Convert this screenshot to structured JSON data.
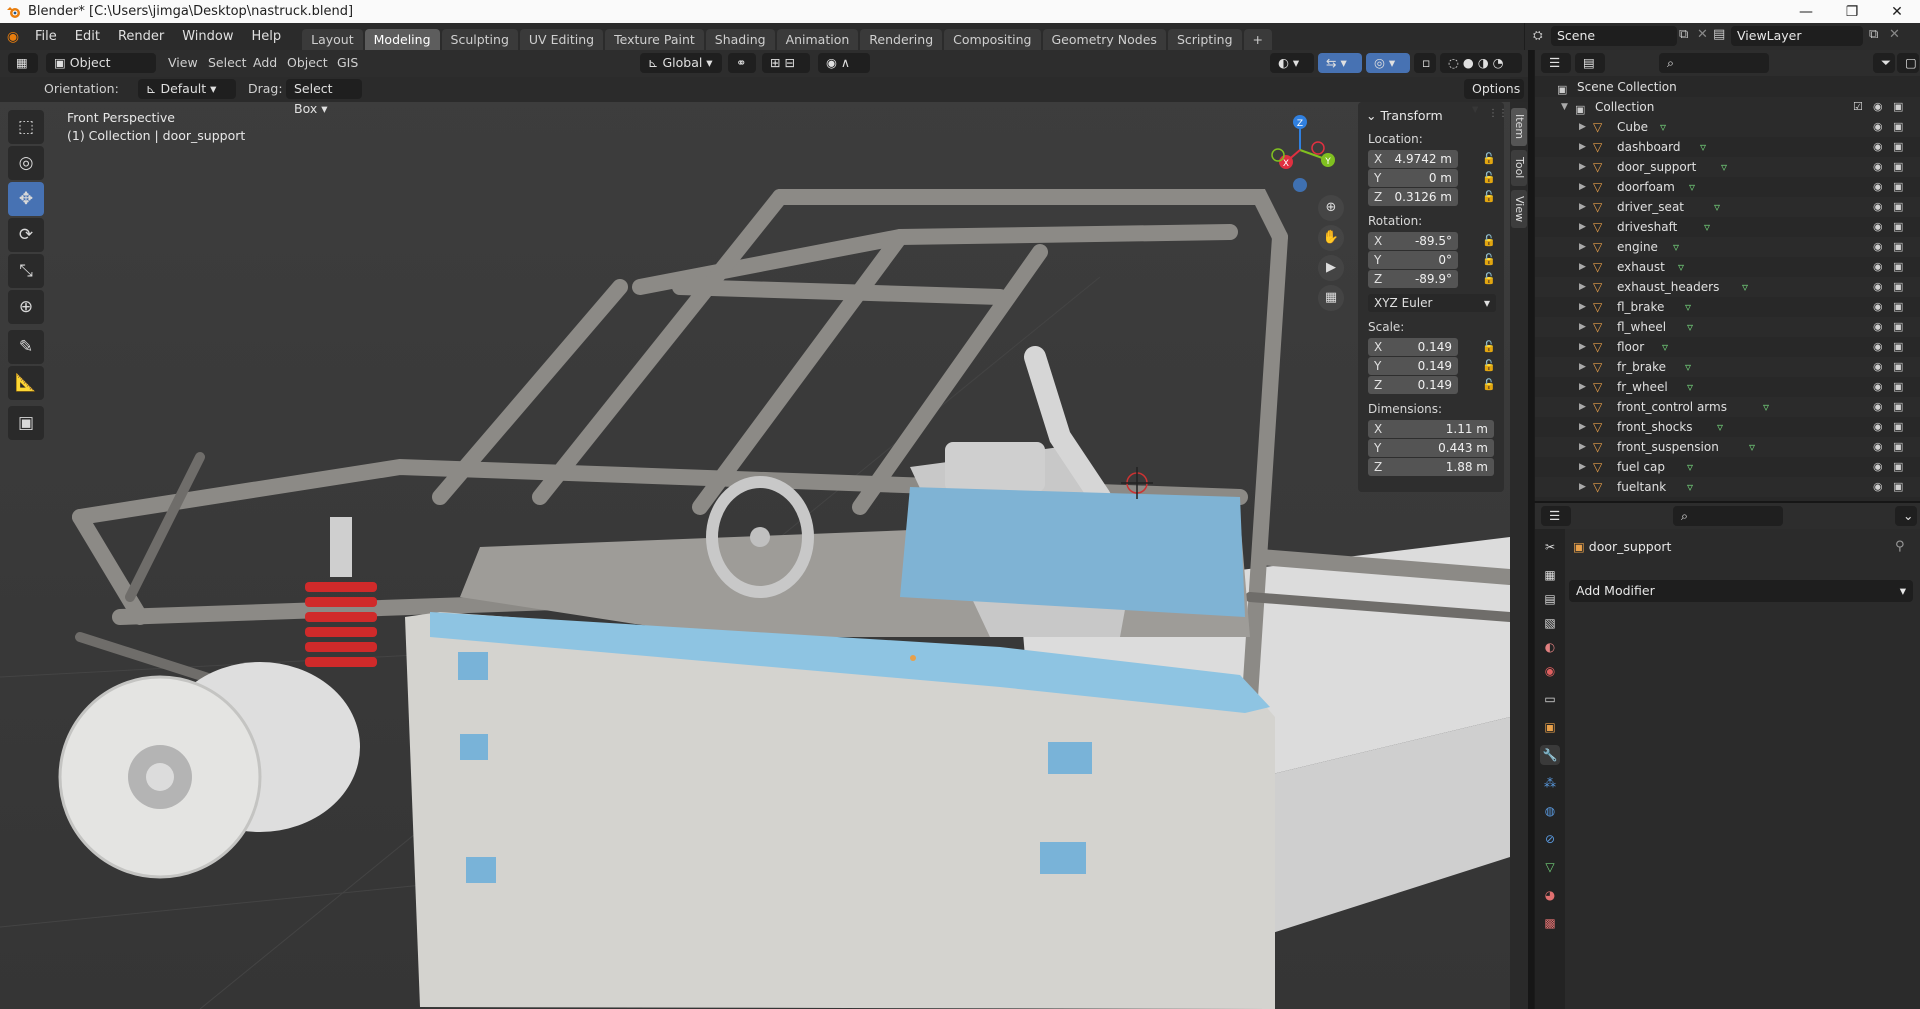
{
  "window": {
    "title": "Blender* [C:\\Users\\jimga\\Desktop\\nastruck.blend]",
    "minimize": "—",
    "maximize": "❐",
    "close": "✕"
  },
  "menu": [
    "File",
    "Edit",
    "Render",
    "Window",
    "Help"
  ],
  "workspaces": [
    "Layout",
    "Modeling",
    "Sculpting",
    "UV Editing",
    "Texture Paint",
    "Shading",
    "Animation",
    "Rendering",
    "Compositing",
    "Geometry Nodes",
    "Scripting"
  ],
  "add_workspace": "+",
  "scene": {
    "name": "Scene",
    "view_layer": "ViewLayer"
  },
  "viewport_header": {
    "mode": "Object Mode",
    "menus": [
      "View",
      "Select",
      "Add",
      "Object",
      "GIS"
    ],
    "transform_orientation": "Global"
  },
  "tool_settings": {
    "orientation_label": "Orientation:",
    "orientation_value": "Default",
    "drag_label": "Drag:",
    "drag_value": "Select Box",
    "options": "Options"
  },
  "viewport_info": {
    "view": "Front Perspective",
    "collection": "(1) Collection | door_support"
  },
  "gizmo": {
    "x": "X",
    "y": "Y",
    "z": "Z"
  },
  "npanel": {
    "header": "Transform",
    "location_label": "Location:",
    "location": [
      {
        "axis": "X",
        "value": "4.9742 m"
      },
      {
        "axis": "Y",
        "value": "0 m"
      },
      {
        "axis": "Z",
        "value": "0.3126 m"
      }
    ],
    "rotation_label": "Rotation:",
    "rotation": [
      {
        "axis": "X",
        "value": "-89.5°"
      },
      {
        "axis": "Y",
        "value": "0°"
      },
      {
        "axis": "Z",
        "value": "-89.9°"
      }
    ],
    "rotation_mode": "XYZ Euler",
    "scale_label": "Scale:",
    "scale": [
      {
        "axis": "X",
        "value": "0.149"
      },
      {
        "axis": "Y",
        "value": "0.149"
      },
      {
        "axis": "Z",
        "value": "0.149"
      }
    ],
    "dimensions_label": "Dimensions:",
    "dimensions": [
      {
        "axis": "X",
        "value": "1.11 m"
      },
      {
        "axis": "Y",
        "value": "0.443 m"
      },
      {
        "axis": "Z",
        "value": "1.88 m"
      }
    ],
    "tabs": [
      "Item",
      "Tool",
      "View"
    ]
  },
  "outliner": {
    "root": "Scene Collection",
    "collection": "Collection",
    "items": [
      "Cube",
      "dashboard",
      "door_support",
      "doorfoam",
      "driver_seat",
      "driveshaft",
      "engine",
      "exhaust",
      "exhaust_headers",
      "fl_brake",
      "fl_wheel",
      "floor",
      "fr_brake",
      "fr_wheel",
      "front_control arms",
      "front_shocks",
      "front_suspension",
      "fuel cap",
      "fueltank"
    ],
    "selected": "door_support"
  },
  "properties": {
    "object_name": "door_support",
    "add_modifier": "Add Modifier"
  },
  "colors": {
    "accent": "#4772b3",
    "modifier_green": "#73d17a",
    "object_orange": "#e8a04a",
    "gizmo_x": "#e03040",
    "gizmo_y": "#80c020",
    "gizmo_z": "#3080e0"
  }
}
